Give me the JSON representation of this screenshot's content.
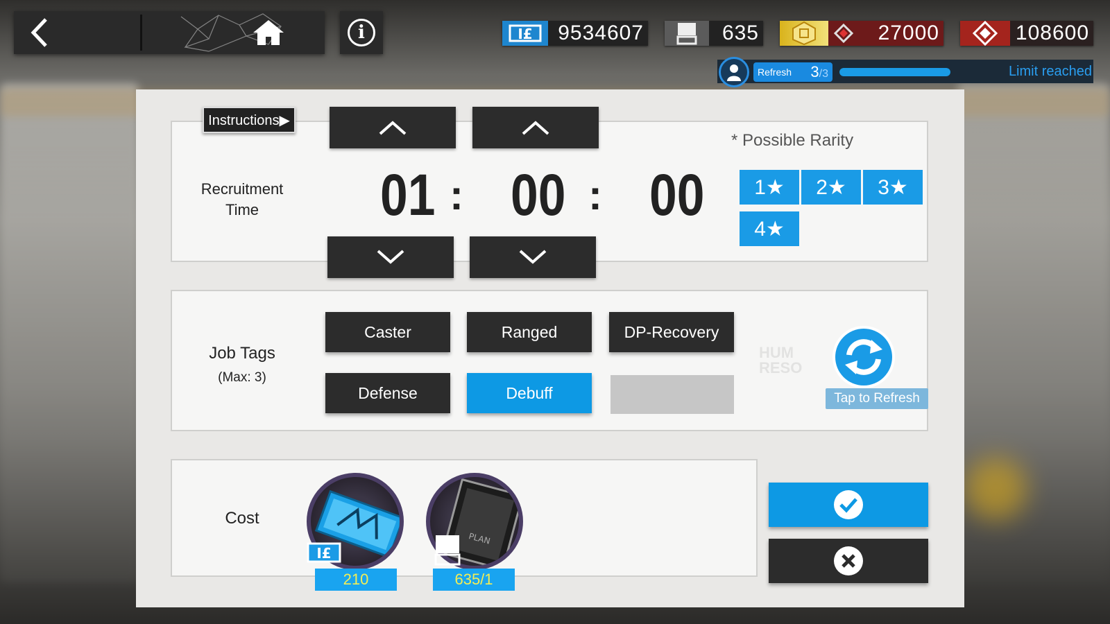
{
  "nav": {
    "back_icon": "chevron-left-icon",
    "home_icon": "home-icon",
    "info_icon": "info-icon"
  },
  "resources": {
    "recruitment_permits": "9534607",
    "expedited_plans": "635",
    "lmd": "27000",
    "orundum": "108600"
  },
  "refresh": {
    "label": "Refresh",
    "current": "3",
    "max": "/3",
    "fill_fraction": 1.0,
    "status": "Limit reached"
  },
  "recruit": {
    "instructions_label": "Instructions▶",
    "time_label_line1": "Recruitment",
    "time_label_line2": "Time",
    "hours": "01",
    "minutes": "00",
    "seconds": "00",
    "colon": ":",
    "rarity_title": "* Possible Rarity",
    "rarities": [
      "1★",
      "2★",
      "3★",
      "4★"
    ]
  },
  "tags": {
    "label": "Job Tags",
    "max_label": "(Max: 3)",
    "items": [
      {
        "label": "Caster",
        "selected": false
      },
      {
        "label": "Ranged",
        "selected": false
      },
      {
        "label": "DP-Recovery",
        "selected": false
      },
      {
        "label": "Defense",
        "selected": false
      },
      {
        "label": "Debuff",
        "selected": true
      },
      {
        "label": "",
        "selected": false
      }
    ],
    "refresh_label": "Tap to Refresh"
  },
  "cost": {
    "label": "Cost",
    "items": [
      {
        "name": "recruitment-permit",
        "qty": "210"
      },
      {
        "name": "expedited-plan",
        "qty": "635/1"
      }
    ]
  },
  "actions": {
    "confirm_icon": "check-icon",
    "cancel_icon": "close-icon"
  },
  "colors": {
    "accent": "#1a9be6",
    "dark_button": "#2c2c2c",
    "qty_text": "#f3ee55",
    "lmd_bg": "#6d1a1a",
    "orundum_bg": "#a4241d"
  }
}
